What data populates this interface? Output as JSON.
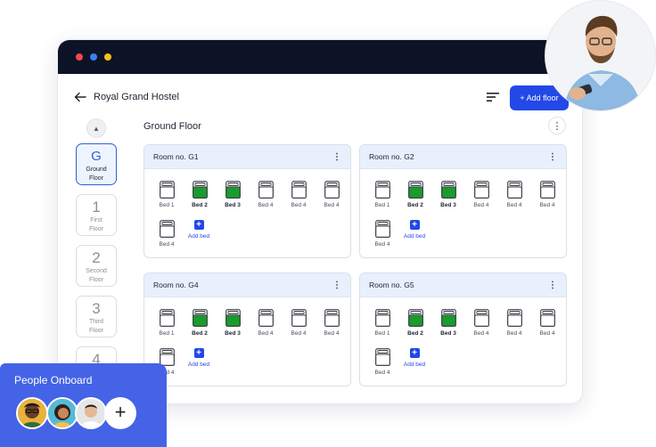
{
  "app": {
    "title": "Royal Grand Hostel",
    "add_floor_label": "+ Add floor"
  },
  "floors": [
    {
      "key": "G",
      "label_line1": "Ground",
      "label_line2": "Floor"
    },
    {
      "key": "1",
      "label_line1": "First",
      "label_line2": "Floor"
    },
    {
      "key": "2",
      "label_line1": "Second",
      "label_line2": "Floor"
    },
    {
      "key": "3",
      "label_line1": "Third",
      "label_line2": "Floor"
    },
    {
      "key": "4",
      "label_line1": "",
      "label_line2": ""
    }
  ],
  "current_floor_title": "Ground Floor",
  "rooms": [
    {
      "name": "Room no. G1"
    },
    {
      "name": "Room no. G2"
    },
    {
      "name": "Room no. G4"
    },
    {
      "name": "Room no. G5"
    }
  ],
  "beds": [
    {
      "label": "Bed 1",
      "occupied": false
    },
    {
      "label": "Bed 2",
      "occupied": true
    },
    {
      "label": "Bed 3",
      "occupied": true
    },
    {
      "label": "Bed 4",
      "occupied": false
    },
    {
      "label": "Bed 4",
      "occupied": false
    },
    {
      "label": "Bed 4",
      "occupied": false
    },
    {
      "label": "Bed 4",
      "occupied": false
    }
  ],
  "add_bed_label": "Add bed",
  "people_onboard": {
    "title": "People Onboard",
    "add_label": "+"
  },
  "colors": {
    "accent": "#2348e8",
    "occupied": "#1a9b2c",
    "titlebar": "#0c1327",
    "people_card": "#4563e6"
  }
}
